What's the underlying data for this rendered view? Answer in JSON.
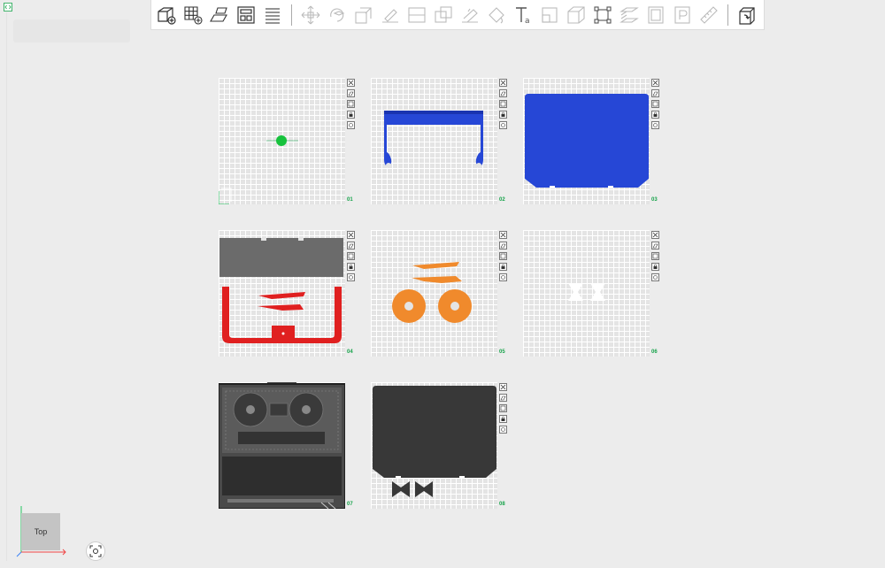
{
  "toolbar": {
    "icons": [
      "add-object-icon",
      "add-plate-icon",
      "auto-arrange-icon",
      "layout-plate-icon",
      "plate-list-icon",
      "move-icon",
      "rotate-icon",
      "scale-icon",
      "lay-on-face-icon",
      "cut-icon",
      "boolean-icon",
      "support-paint-icon",
      "color-paint-icon",
      "text-icon",
      "seam-icon",
      "measure-icon",
      "assemble-icon",
      "slice-layers-icon",
      "plate-p-icon",
      "plate-p2-icon",
      "ruler-icon",
      "export-icon"
    ]
  },
  "plates": [
    {
      "number": "01"
    },
    {
      "number": "02"
    },
    {
      "number": "03"
    },
    {
      "number": "04"
    },
    {
      "number": "05"
    },
    {
      "number": "06"
    },
    {
      "number": "07"
    },
    {
      "number": "08"
    }
  ],
  "view_cube": {
    "label": "Top"
  },
  "colors": {
    "blue": "#2647d6",
    "red": "#e02020",
    "orange": "#f08a2c",
    "dark": "#383838",
    "green": "#16a34a"
  }
}
